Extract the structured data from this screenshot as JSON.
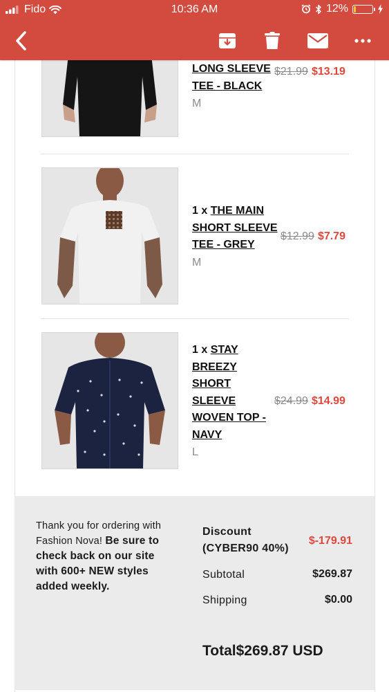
{
  "status_bar": {
    "carrier": "Fido",
    "time": "10:36 AM",
    "battery": "12%",
    "battery_level": 0.12
  },
  "navbar": {
    "back_icon": "chevron-left-icon",
    "actions": [
      "archive-icon",
      "trash-icon",
      "mail-icon",
      "more-icon"
    ]
  },
  "products": [
    {
      "quantity": "",
      "name": "LONG SLEEVE TEE - BLACK",
      "name_lines": [
        "LONG SLEEVE",
        "TEE - BLACK"
      ],
      "size": "M",
      "old_price": "$21.99",
      "new_price": "$13.19"
    },
    {
      "quantity": "1 x",
      "name": "THE MAIN SHORT SLEEVE TEE - GREY",
      "name_lines": [
        "THE MAIN",
        "SHORT SLEEVE",
        "TEE - GREY"
      ],
      "size": "M",
      "old_price": "$12.99",
      "new_price": "$7.79"
    },
    {
      "quantity": "1 x",
      "name": "STAY BREEZY SHORT SLEEVE WOVEN TOP - NAVY",
      "name_lines": [
        "STAY",
        "BREEZY",
        "SHORT",
        "SLEEVE",
        "WOVEN TOP -",
        "NAVY"
      ],
      "size": "L",
      "old_price": "$24.99",
      "new_price": "$14.99"
    }
  ],
  "summary": {
    "thanks_plain": "Thank you for ordering with Fashion Nova!",
    "thanks_bold": "Be sure to check back on our site with 600+ NEW styles added weekly.",
    "discount_label_1": "Discount",
    "discount_label_2": "(CYBER90 40%)",
    "discount_value": "$-179.91",
    "subtotal_label": "Subtotal",
    "subtotal_value": "$269.87",
    "shipping_label": "Shipping",
    "shipping_value": "$0.00",
    "total_label": "Total",
    "total_value": "$269.87 USD"
  },
  "colors": {
    "header": "#d34b3f",
    "sale_price": "#e0473b",
    "summary_bg": "#ebebeb"
  }
}
